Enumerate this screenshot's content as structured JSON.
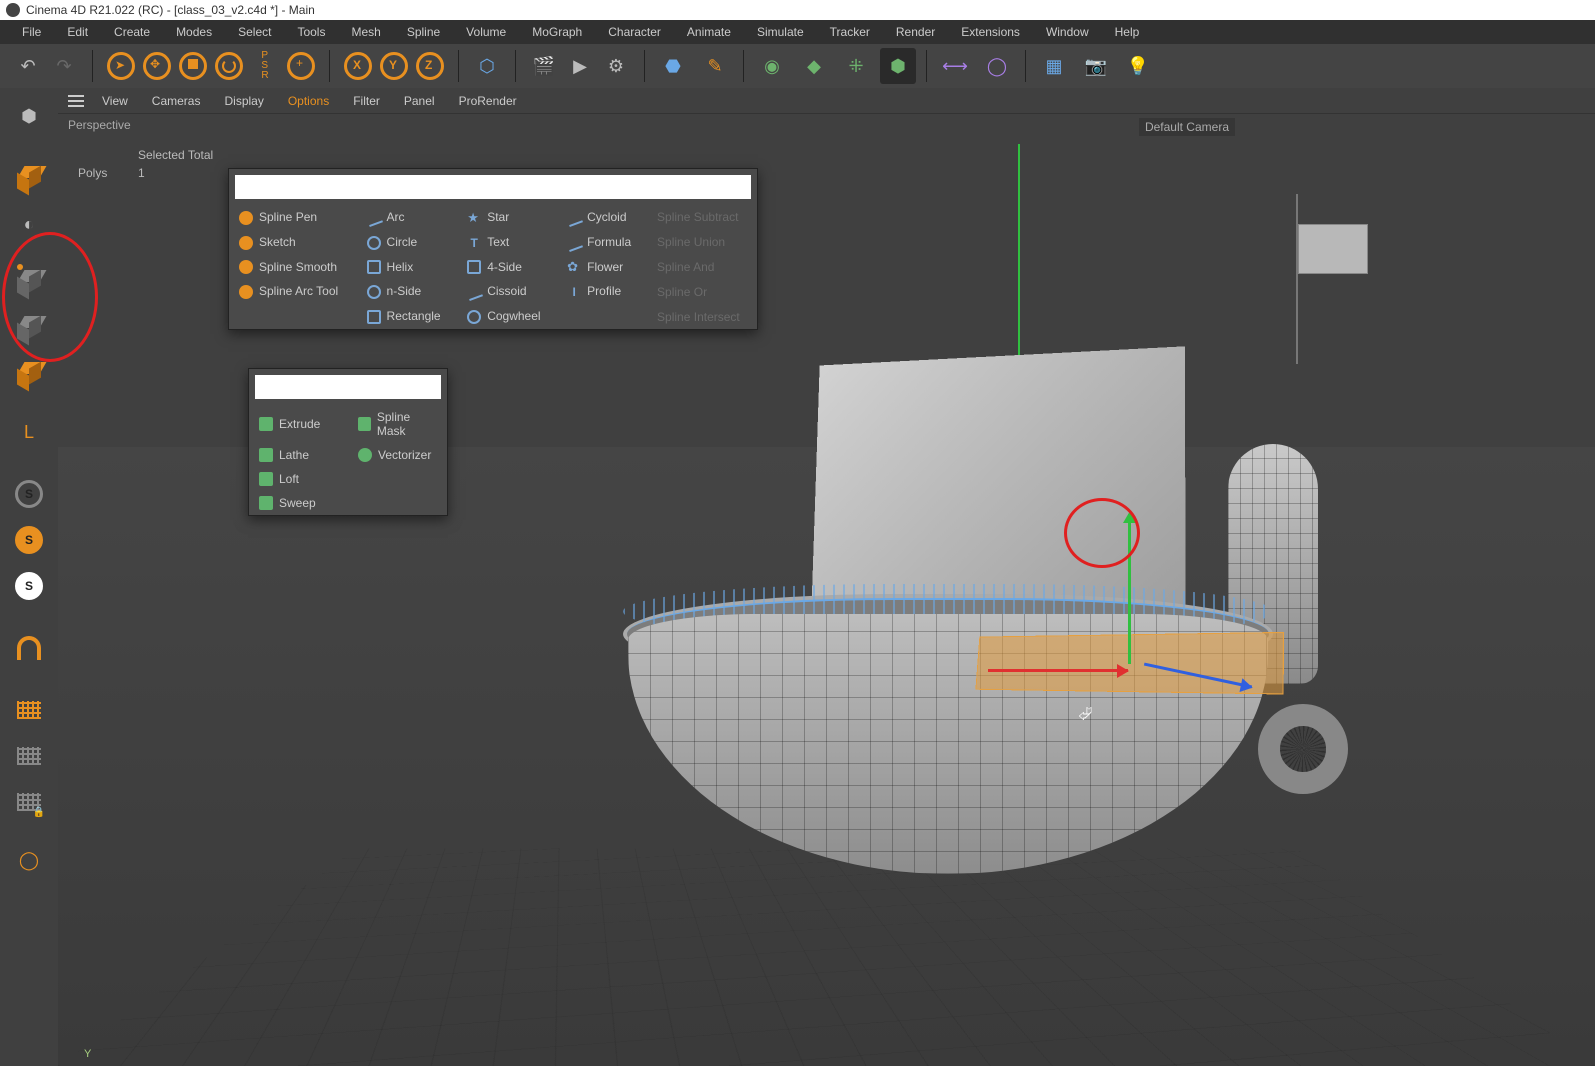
{
  "title": "Cinema 4D R21.022 (RC) - [class_03_v2.c4d *] - Main",
  "menubar": [
    "File",
    "Edit",
    "Create",
    "Modes",
    "Select",
    "Tools",
    "Mesh",
    "Spline",
    "Volume",
    "MoGraph",
    "Character",
    "Animate",
    "Simulate",
    "Tracker",
    "Render",
    "Extensions",
    "Window",
    "Help"
  ],
  "vp_menu": [
    "View",
    "Cameras",
    "Display",
    "Options",
    "Filter",
    "Panel",
    "ProRender"
  ],
  "vp_menu_active_index": 3,
  "vp_label": "Perspective",
  "camera_label": "Default Camera ",
  "stats": {
    "header": "Selected Total",
    "row_label": "Polys",
    "row_value": "1"
  },
  "spline_popup": {
    "cols": [
      [
        "Spline Pen",
        "Sketch",
        "Spline Smooth",
        "Spline Arc Tool",
        ""
      ],
      [
        "Arc",
        "Circle",
        "Helix",
        "n-Side",
        "Rectangle"
      ],
      [
        "Star",
        "Text",
        "4-Side",
        "Cissoid",
        "Cogwheel"
      ],
      [
        "Cycloid",
        "Formula",
        "Flower",
        "Profile",
        ""
      ],
      [
        "Spline Subtract",
        "Spline Union",
        "Spline And",
        "Spline Or",
        "Spline Intersect"
      ]
    ]
  },
  "gen_popup": {
    "rows": [
      [
        "Extrude",
        "Spline Mask"
      ],
      [
        "Lathe",
        "Vectorizer"
      ],
      [
        "Loft",
        ""
      ],
      [
        "Sweep",
        ""
      ]
    ]
  },
  "axis_label": "Y"
}
